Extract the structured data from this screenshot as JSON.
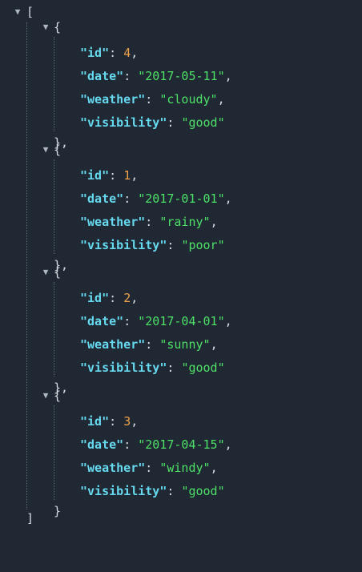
{
  "toggle_glyph": "▼",
  "root": {
    "open": "[",
    "close": "]"
  },
  "object_open": "{",
  "object_close": "}",
  "object_close_comma": "},",
  "items": [
    {
      "fields": [
        {
          "key": "\"id\"",
          "value": "4",
          "type": "number",
          "trail": ","
        },
        {
          "key": "\"date\"",
          "value": "\"2017-05-11\"",
          "type": "string",
          "trail": ","
        },
        {
          "key": "\"weather\"",
          "value": "\"cloudy\"",
          "type": "string",
          "trail": ","
        },
        {
          "key": "\"visibility\"",
          "value": "\"good\"",
          "type": "string",
          "trail": ""
        }
      ]
    },
    {
      "fields": [
        {
          "key": "\"id\"",
          "value": "1",
          "type": "number",
          "trail": ","
        },
        {
          "key": "\"date\"",
          "value": "\"2017-01-01\"",
          "type": "string",
          "trail": ","
        },
        {
          "key": "\"weather\"",
          "value": "\"rainy\"",
          "type": "string",
          "trail": ","
        },
        {
          "key": "\"visibility\"",
          "value": "\"poor\"",
          "type": "string",
          "trail": ""
        }
      ]
    },
    {
      "fields": [
        {
          "key": "\"id\"",
          "value": "2",
          "type": "number",
          "trail": ","
        },
        {
          "key": "\"date\"",
          "value": "\"2017-04-01\"",
          "type": "string",
          "trail": ","
        },
        {
          "key": "\"weather\"",
          "value": "\"sunny\"",
          "type": "string",
          "trail": ","
        },
        {
          "key": "\"visibility\"",
          "value": "\"good\"",
          "type": "string",
          "trail": ""
        }
      ]
    },
    {
      "fields": [
        {
          "key": "\"id\"",
          "value": "3",
          "type": "number",
          "trail": ","
        },
        {
          "key": "\"date\"",
          "value": "\"2017-04-15\"",
          "type": "string",
          "trail": ","
        },
        {
          "key": "\"weather\"",
          "value": "\"windy\"",
          "type": "string",
          "trail": ","
        },
        {
          "key": "\"visibility\"",
          "value": "\"good\"",
          "type": "string",
          "trail": ""
        }
      ]
    }
  ]
}
